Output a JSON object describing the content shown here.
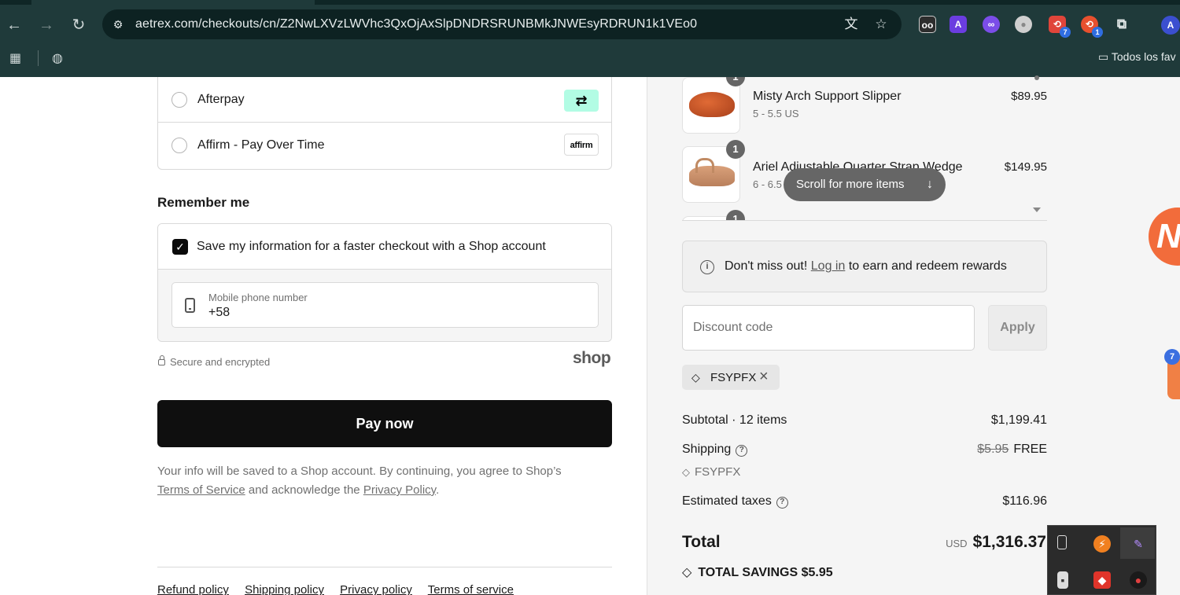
{
  "browser": {
    "url": "aetrex.com/checkouts/cn/Z2NwLXVzLWVhc3QxOjAxSlpDNDRSRUNBMkJNWEsyRDRUN1k1VEo0",
    "bookmarks_folder": "Todos los fav",
    "extensions": [
      {
        "name": "reader",
        "glyph": "oo",
        "color": "#2d2d2d"
      },
      {
        "name": "font-a",
        "glyph": "A",
        "color": "#6b3de0"
      },
      {
        "name": "link",
        "glyph": "∞",
        "color": "#7b4de8"
      },
      {
        "name": "chrome",
        "glyph": "●",
        "color": "#cfcfcf"
      },
      {
        "name": "ext-red",
        "glyph": "⟲",
        "color": "#e0453a",
        "badge": "7"
      },
      {
        "name": "ext-orange",
        "glyph": "⟲",
        "color": "#e8502e",
        "badge": "1"
      },
      {
        "name": "puzzle",
        "glyph": "⧉",
        "color": "transparent"
      }
    ],
    "profile_initial": "A"
  },
  "payment": {
    "options": [
      {
        "label": "Afterpay",
        "logo": "⇄"
      },
      {
        "label": "Affirm - Pay Over Time",
        "logo": "affirm"
      }
    ]
  },
  "remember": {
    "title": "Remember me",
    "checkbox_label": "Save my information for a faster checkout with a Shop account",
    "phone_label": "Mobile phone number",
    "phone_value": "+58",
    "secure_text": "Secure and encrypted",
    "shop_logo": "shop"
  },
  "pay_now_label": "Pay now",
  "legal": {
    "prefix": "Your info will be saved to a Shop account. By continuing, you agree to Shop’s",
    "terms": "Terms of Service",
    "middle": "and acknowledge the",
    "privacy": "Privacy Policy",
    "suffix": "."
  },
  "footer_links": [
    "Refund policy",
    "Shipping policy",
    "Privacy policy",
    "Terms of service"
  ],
  "cart": {
    "items": [
      {
        "name": "Misty Arch Support Slipper",
        "variant": "5 - 5.5 US",
        "price": "$89.95",
        "qty": "1"
      },
      {
        "name": "Ariel Adjustable Quarter Strap Wedge",
        "variant": "6 - 6.5 US",
        "price": "$149.95",
        "qty": "1"
      },
      {
        "qty": "1"
      }
    ],
    "scroll_hint": "Scroll for more items",
    "scroll_arrow": "↓"
  },
  "rewards": {
    "prefix": "Don't miss out!",
    "link": "Log in",
    "suffix": "to earn and redeem rewards"
  },
  "discount": {
    "placeholder": "Discount code",
    "apply_label": "Apply",
    "applied_code": "FSYPFX"
  },
  "summary": {
    "subtotal_label": "Subtotal · 12 items",
    "subtotal_value": "$1,199.41",
    "shipping_label": "Shipping",
    "shipping_original": "$5.95",
    "shipping_value": "FREE",
    "shipping_code": "FSYPFX",
    "taxes_label": "Estimated taxes",
    "taxes_value": "$116.96",
    "total_label": "Total",
    "total_currency": "USD",
    "total_value": "$1,316.37",
    "savings_label": "TOTAL SAVINGS",
    "savings_value": "$5.95"
  },
  "widgets": {
    "float_logo": "N",
    "float_badge": "7"
  }
}
